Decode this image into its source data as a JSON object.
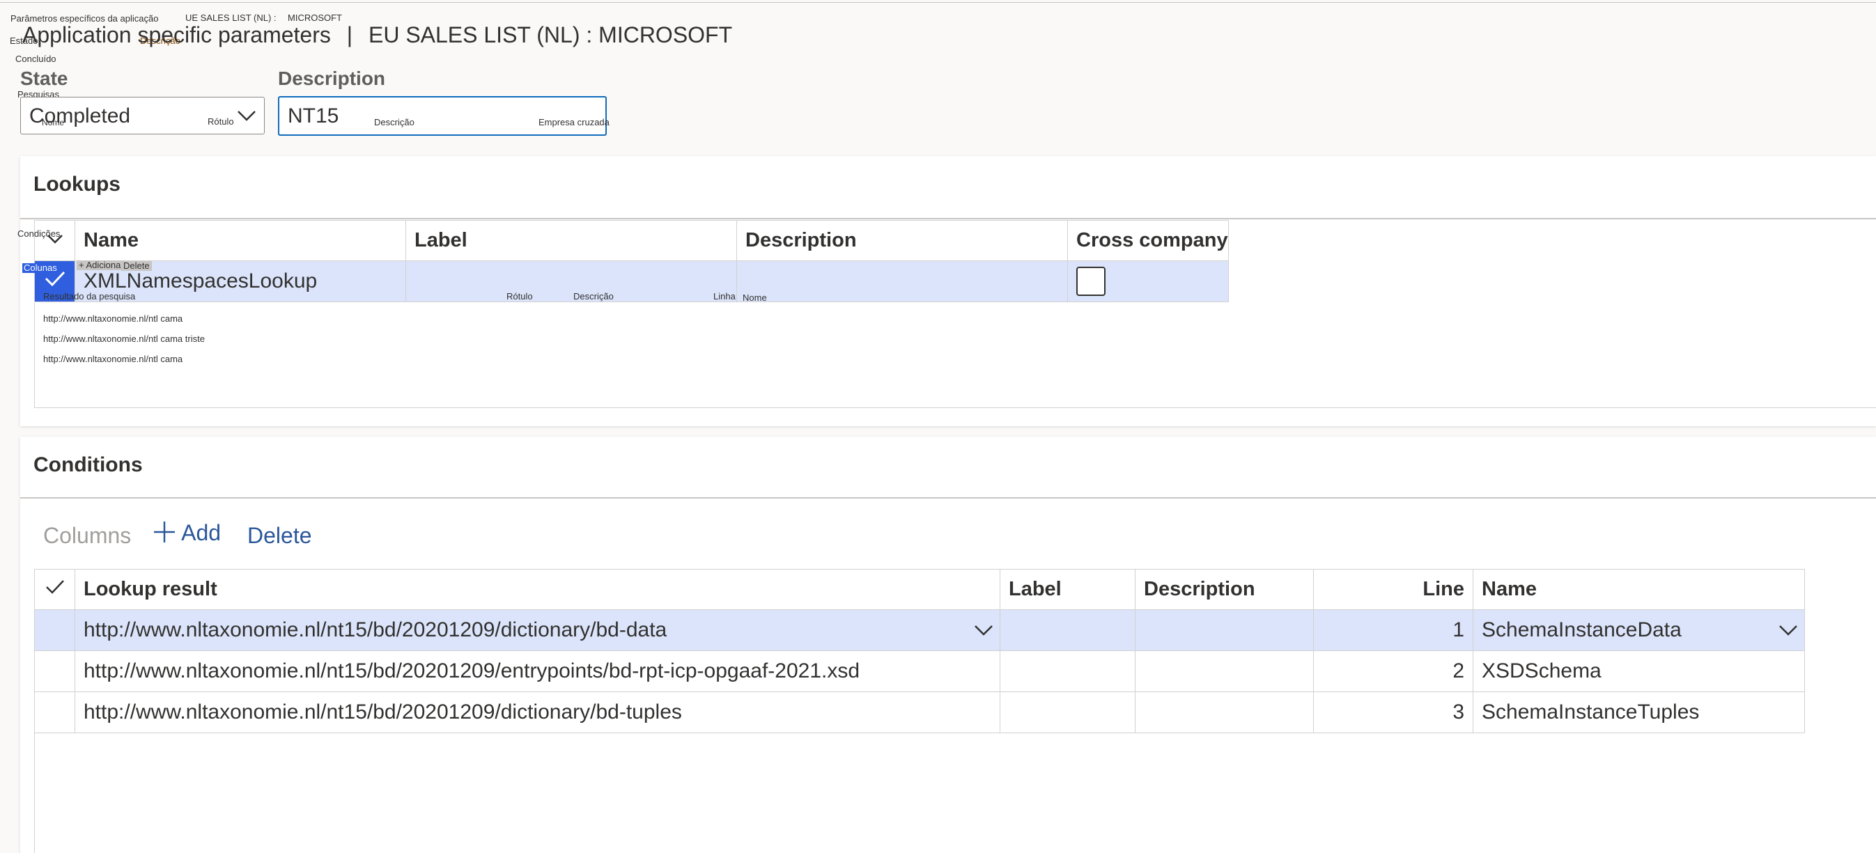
{
  "overlay": {
    "params_pt": "Parâmetros específicos da aplicação",
    "ue_sales": "UE SALES  LIST (NL) :",
    "microsoft": "MICROSOFT",
    "estado": "Estado",
    "descricao": "Descrição",
    "concluido": "Concluído",
    "pesquisas": "Pesquisas",
    "nome": "Nome",
    "rotulo": "Rótulo",
    "descricao2": "Descrição",
    "empresa_cruzada": "Empresa cruzada",
    "condicoes": "Condições",
    "colunas": "Colunas",
    "adicionar": "+ Adicionar",
    "delete": "Delete",
    "resultado": "Resultado da pesquisa",
    "rotulo2": "Rótulo",
    "descricao3": "Descrição",
    "linha": "Linha",
    "nome2": "Nome",
    "url1": "http://www.nltaxonomie.nl/ntl cama",
    "url2": "http://www.nltaxonomie.nl/ntl cama triste",
    "url3": "http://www.nltaxonomie.nl/ntl cama"
  },
  "header": {
    "title": "Application specific parameters",
    "separator": "|",
    "subtitle": "EU SALES LIST (NL) : MICROSOFT"
  },
  "fields": {
    "state_label": "State",
    "state_value": "Completed",
    "description_label": "Description",
    "description_value": "NT15"
  },
  "lookups": {
    "title": "Lookups",
    "columns": [
      "Name",
      "Label",
      "Description",
      "Cross company"
    ],
    "rows": [
      {
        "name": "XMLNamespacesLookup",
        "label": "",
        "description": "",
        "cross_company": false
      }
    ]
  },
  "conditions": {
    "title": "Conditions",
    "toolbar": {
      "columns": "Columns",
      "add": "Add",
      "delete": "Delete"
    },
    "columns": [
      "Lookup result",
      "Label",
      "Description",
      "Line",
      "Name"
    ],
    "rows": [
      {
        "lookup_result": "http://www.nltaxonomie.nl/nt15/bd/20201209/dictionary/bd-data",
        "label": "",
        "description": "",
        "line": "1",
        "name": "SchemaInstanceData"
      },
      {
        "lookup_result": "http://www.nltaxonomie.nl/nt15/bd/20201209/entrypoints/bd-rpt-icp-opgaaf-2021.xsd",
        "label": "",
        "description": "",
        "line": "2",
        "name": "XSDSchema"
      },
      {
        "lookup_result": "http://www.nltaxonomie.nl/nt15/bd/20201209/dictionary/bd-tuples",
        "label": "",
        "description": "",
        "line": "3",
        "name": "SchemaInstanceTuples"
      }
    ]
  },
  "colors": {
    "accent": "#0f6cbd",
    "selected_row": "#dbe4fa",
    "selection_blue": "#2f5fde",
    "link_blue": "#2b579a"
  },
  "icons": [
    "chevron-down-icon",
    "checkmark-icon",
    "plus-icon"
  ]
}
